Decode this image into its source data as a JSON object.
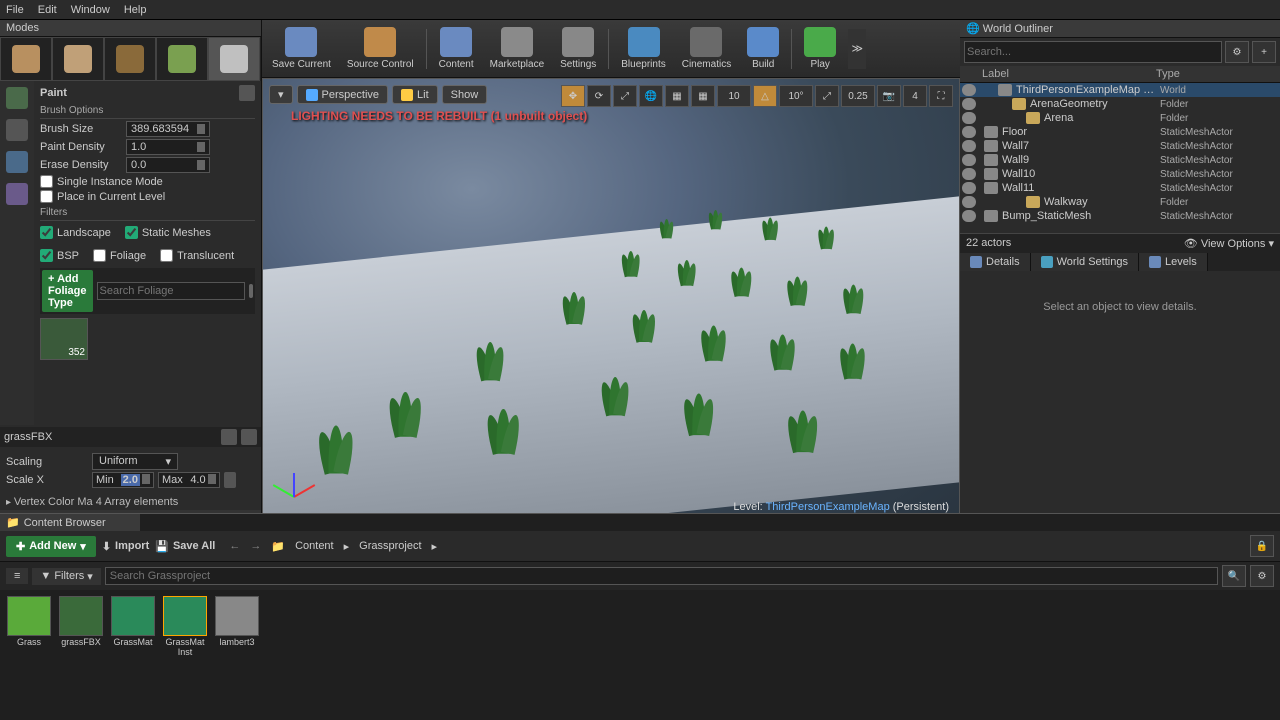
{
  "menu": {
    "file": "File",
    "edit": "Edit",
    "window": "Window",
    "help": "Help"
  },
  "modes": {
    "title": "Modes"
  },
  "paint": {
    "title": "Paint",
    "brush_options": "Brush Options",
    "brush_size_label": "Brush Size",
    "brush_size": "389.683594",
    "paint_density_label": "Paint Density",
    "paint_density": "1.0",
    "erase_density_label": "Erase Density",
    "erase_density": "0.0",
    "single_instance": "Single Instance Mode",
    "place_level": "Place in Current Level",
    "filters": "Filters",
    "landscape": "Landscape",
    "static_meshes": "Static Meshes",
    "bsp": "BSP",
    "foliage": "Foliage",
    "translucent": "Translucent",
    "add_foliage": "+ Add Foliage Type",
    "search_placeholder": "Search Foliage",
    "thumb_count": "352",
    "selected": "grassFBX",
    "scaling_label": "Scaling",
    "scaling_value": "Uniform",
    "scalex_label": "Scale X",
    "min_label": "Min",
    "min": "2.0",
    "max_label": "Max",
    "max": "4.0",
    "vertex": "Vertex Color Ma 4 Array elements"
  },
  "toolbar": {
    "save": "Save Current",
    "source": "Source Control",
    "content": "Content",
    "marketplace": "Marketplace",
    "settings": "Settings",
    "blueprints": "Blueprints",
    "cinematics": "Cinematics",
    "build": "Build",
    "play": "Play"
  },
  "viewport": {
    "perspective": "Perspective",
    "lit": "Lit",
    "show": "Show",
    "error": "LIGHTING NEEDS TO BE REBUILT (1 unbuilt object)",
    "snap1": "10",
    "snap2": "10°",
    "snap3": "0.25",
    "cam": "4",
    "level_label": "Level:  ",
    "level_map": "ThirdPersonExampleMap",
    "level_persist": " (Persistent)"
  },
  "outliner": {
    "title": "World Outliner",
    "search_placeholder": "Search...",
    "label": "Label",
    "type": "Type",
    "items": [
      {
        "ind": 1,
        "ic": "w",
        "name": "ThirdPersonExampleMap (Editor)",
        "type": "World",
        "sel": true
      },
      {
        "ind": 2,
        "ic": "f",
        "name": "ArenaGeometry",
        "type": "Folder"
      },
      {
        "ind": 3,
        "ic": "f",
        "name": "Arena",
        "type": "Folder"
      },
      {
        "ind": 4,
        "ic": "a",
        "name": "Floor",
        "type": "StaticMeshActor"
      },
      {
        "ind": 4,
        "ic": "a",
        "name": "Wall7",
        "type": "StaticMeshActor"
      },
      {
        "ind": 4,
        "ic": "a",
        "name": "Wall9",
        "type": "StaticMeshActor"
      },
      {
        "ind": 4,
        "ic": "a",
        "name": "Wall10",
        "type": "StaticMeshActor"
      },
      {
        "ind": 4,
        "ic": "a",
        "name": "Wall11",
        "type": "StaticMeshActor"
      },
      {
        "ind": 3,
        "ic": "f",
        "name": "Walkway",
        "type": "Folder"
      },
      {
        "ind": 4,
        "ic": "a",
        "name": "Bump_StaticMesh",
        "type": "StaticMeshActor"
      }
    ],
    "count": "22 actors",
    "view_options": "View Options"
  },
  "details": {
    "tab_details": "Details",
    "tab_world": "World Settings",
    "tab_levels": "Levels",
    "empty": "Select an object to view details."
  },
  "cb": {
    "title": "Content Browser",
    "add": "Add New",
    "import": "Import",
    "saveall": "Save All",
    "crumb_content": "Content",
    "crumb_project": "Grassproject",
    "filters": "Filters",
    "search_placeholder": "Search Grassproject",
    "assets": [
      {
        "name": "Grass",
        "bg": "#5aaa3a"
      },
      {
        "name": "grassFBX",
        "bg": "#3a6a3a"
      },
      {
        "name": "GrassMat",
        "bg": "#2a8a5a"
      },
      {
        "name": "GrassMat Inst",
        "bg": "#2a8a5a",
        "sel": true
      },
      {
        "name": "lambert3",
        "bg": "#888"
      }
    ]
  }
}
